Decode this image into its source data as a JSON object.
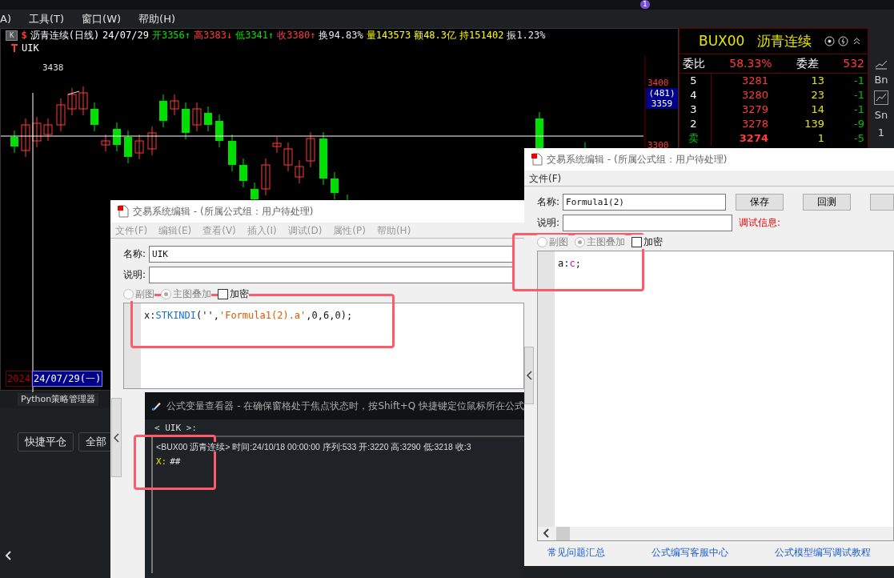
{
  "top_strip": {
    "badge": "1"
  },
  "menu_bar": {
    "items": [
      "A)",
      "工具(T)",
      "窗口(W)",
      "帮助(H)"
    ]
  },
  "quote_header": {
    "chart_button": "K",
    "dollar": "$",
    "title": "沥青连续(日线)",
    "date": "24/07/29",
    "stats": [
      {
        "text": "开3356↑",
        "color": "#00e000"
      },
      {
        "text": "高3383↓",
        "color": "#ff3b3b"
      },
      {
        "text": "低3341↑",
        "color": "#00e000"
      },
      {
        "text": "收3380↑",
        "color": "#ff3b3b"
      },
      {
        "text": "换94.83%",
        "color": "#e8e8e8"
      },
      {
        "text": "量143573",
        "color": "#ffff00"
      },
      {
        "text": "额48.3亿",
        "color": "#ffff00"
      },
      {
        "text": "持151402",
        "color": "#ffff00"
      },
      {
        "text": "振1.23%",
        "color": "#e8e8e8"
      }
    ]
  },
  "indicator_label": "UIK",
  "chart": {
    "high_label": "3438",
    "price_labels": [
      "3400",
      "3300"
    ],
    "crosshair_bar": "(481)",
    "crosshair_price": "3359",
    "year": "2024",
    "date_label": "24/07/29(一)"
  },
  "order_book": {
    "code": "BUX00",
    "name": "沥青连续",
    "ratio_label": "委比",
    "ratio": "58.33%",
    "diff_label": "委差",
    "diff": "532",
    "rows": [
      {
        "tier": "5",
        "price": "3281",
        "volume": "13",
        "change": "-1",
        "kind": "ask"
      },
      {
        "tier": "4",
        "price": "3280",
        "volume": "23",
        "change": "-1",
        "kind": "ask"
      },
      {
        "tier": "3",
        "price": "3279",
        "volume": "14",
        "change": "-1",
        "kind": "ask"
      },
      {
        "tier": "2",
        "price": "3278",
        "volume": "139",
        "change": "-9",
        "kind": "ask"
      },
      {
        "tier": "卖",
        "price": "3274",
        "volume": "1",
        "change": "-5",
        "kind": "best"
      }
    ]
  },
  "side_toolbar": {
    "items": [
      {
        "kind": "icon"
      },
      {
        "kind": "text",
        "text": "Bn"
      },
      {
        "kind": "boxed-icon"
      },
      {
        "kind": "text",
        "text": "Sn"
      },
      {
        "kind": "text",
        "text": "1"
      }
    ]
  },
  "bottom_panel": {
    "tab": "Python策略管理器",
    "buttons": [
      "快捷平仓",
      "全部"
    ]
  },
  "editor_left": {
    "title": "交易系统编辑 - (所属公式组：用户待处理)",
    "menu": [
      "文件(F)",
      "编辑(E)",
      "查看(V)",
      "插入(I)",
      "调试(D)",
      "属性(P)",
      "帮助(H)"
    ],
    "name_label": "名称:",
    "name_value": "UIK",
    "desc_label": "说明:",
    "radios": [
      {
        "label": "副图",
        "selected": false
      },
      {
        "label": "主图叠加",
        "selected": true
      }
    ],
    "checkbox": {
      "label": "加密",
      "checked": false
    },
    "code": [
      {
        "text": "x:",
        "kind": "plain"
      },
      {
        "text": "STKINDI",
        "kind": "function"
      },
      {
        "text": "('',",
        "kind": "plain"
      },
      {
        "text": "'Formula1(2).a'",
        "kind": "string"
      },
      {
        "text": ",0,6,0);",
        "kind": "plain"
      }
    ]
  },
  "viewer": {
    "title": "公式变量查看器 - 在确保窗格处于焦点状态时，按Shift+Q 快捷键定位鼠标所在公式",
    "header": "< UIK >:",
    "info_line": "<BUX00 沥青连续> 时间:24/10/18 00:00:00 序列:533 开:3220 高:3290 低:3218 收:3",
    "var_name": "X:",
    "var_value": "##"
  },
  "editor_right": {
    "title": "交易系统编辑 - (所属公式组：用户待处理)",
    "menu": [
      "文件(F)"
    ],
    "name_label": "名称:",
    "name_value": "Formula1(2)",
    "buttons": [
      "保存",
      "回测"
    ],
    "desc_label": "说明:",
    "debug_label": "调试信息:",
    "radios": [
      {
        "label": "副图",
        "selected": false
      },
      {
        "label": "主图叠加",
        "selected": true
      }
    ],
    "checkbox": {
      "label": "加密",
      "checked": false
    },
    "code": [
      {
        "text": "a:",
        "kind": "plain"
      },
      {
        "text": "c",
        "kind": "variable"
      },
      {
        "text": ";",
        "kind": "plain"
      }
    ],
    "links": [
      "常见问题汇总",
      "公式编写客服中心",
      "公式模型编写调试教程"
    ]
  }
}
